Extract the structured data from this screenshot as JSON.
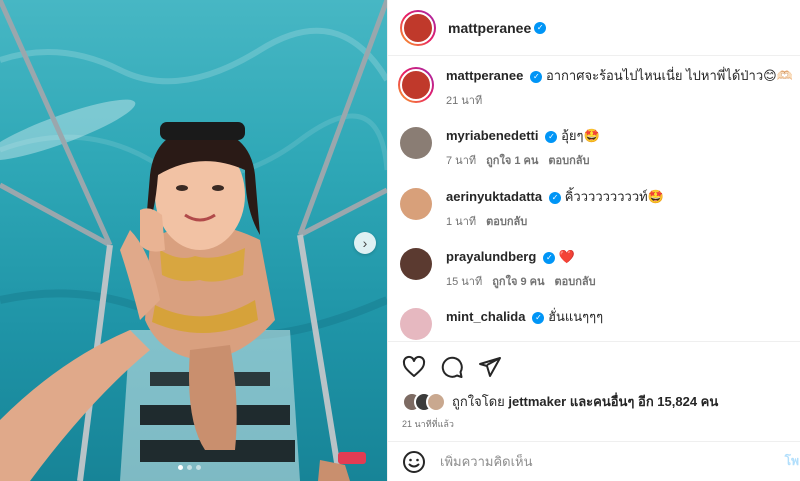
{
  "post": {
    "author": "mattperanee",
    "caption_author": "mattperanee",
    "caption_text": "อากาศจะร้อนไปไหนเนี่ย ไปหาพี่ได้ป่าว😊🫶🏻",
    "caption_time": "21 นาที",
    "carousel_next": "›"
  },
  "comments": [
    {
      "user": "myriabenedetti",
      "text": "อุ้ยๆ🤩",
      "time": "7 นาที",
      "likes": "ถูกใจ 1 คน",
      "reply": "ตอบกลับ",
      "avatar_color": "#8a7d74"
    },
    {
      "user": "aerinyuktadatta",
      "text": "คิ้วววววววววท์🤩",
      "time": "1 นาที",
      "likes": "",
      "reply": "ตอบกลับ",
      "avatar_color": "#d8a07a"
    },
    {
      "user": "prayalundberg",
      "text": "❤️",
      "time": "15 นาที",
      "likes": "ถูกใจ 9 คน",
      "reply": "ตอบกลับ",
      "avatar_color": "#5b3a30"
    },
    {
      "user": "mint_chalida",
      "text": "ฮั่นแนๆๆๆ",
      "time": "",
      "likes": "",
      "reply": "",
      "avatar_color": "#e6b8c0"
    }
  ],
  "likes": {
    "prefix": "ถูกใจโดย",
    "user": "jettmaker",
    "suffix": "และคนอื่นๆ อีก 15,824 คน"
  },
  "posted_ago": "21 นาทีที่แล้ว",
  "add_comment": {
    "placeholder": "เพิ่มความคิดเห็น",
    "post_label": "โพ"
  },
  "colors": {
    "verified": "#0095f6",
    "heart": "#ed4956"
  }
}
